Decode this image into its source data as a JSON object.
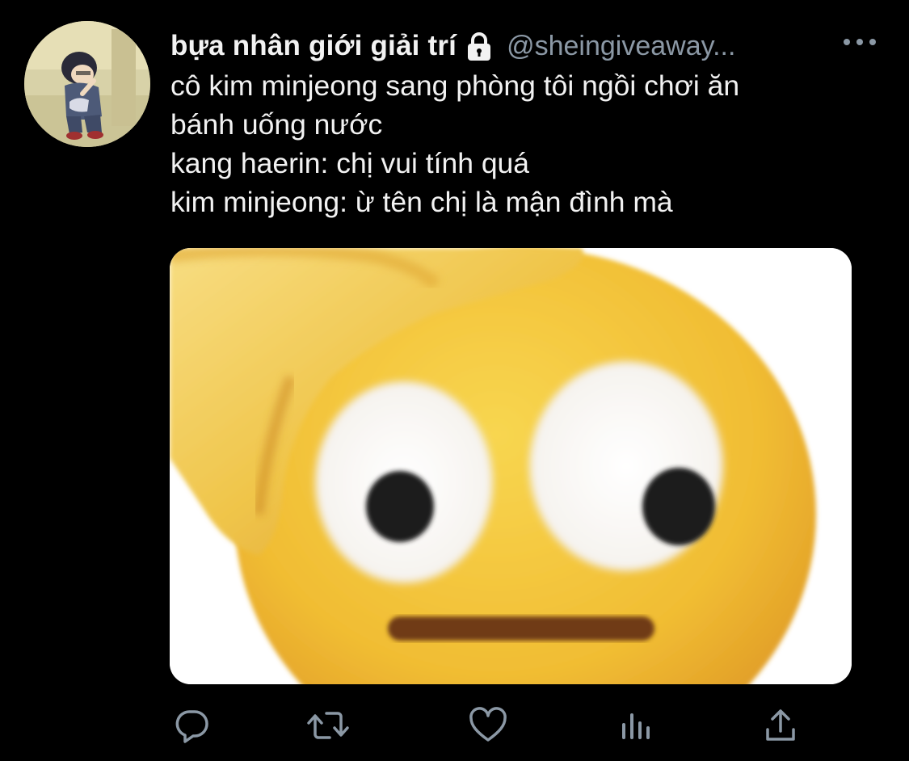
{
  "author": {
    "display_name": "bựa nhân giới giải trí",
    "handle": "@sheingiveaway...",
    "protected_icon": "lock-icon",
    "avatar_icon": "cartoon-character-avatar"
  },
  "tweet": {
    "lines": [
      "cô kim minjeong sang phòng tôi ngồi chơi ăn",
      "bánh uống nước",
      "kang haerin: chị vui tính quá",
      "kim minjeong: ừ tên chị là mận đình mà"
    ],
    "media": {
      "description_icon": "face-palm-emoji-image"
    }
  },
  "actions": {
    "items": [
      "reply-icon",
      "retweet-icon",
      "like-icon",
      "analytics-icon",
      "share-icon"
    ]
  },
  "colors": {
    "background": "#000000",
    "text": "#f2f2f2",
    "secondary": "#8b98a5",
    "icon": "#8b98a5"
  }
}
